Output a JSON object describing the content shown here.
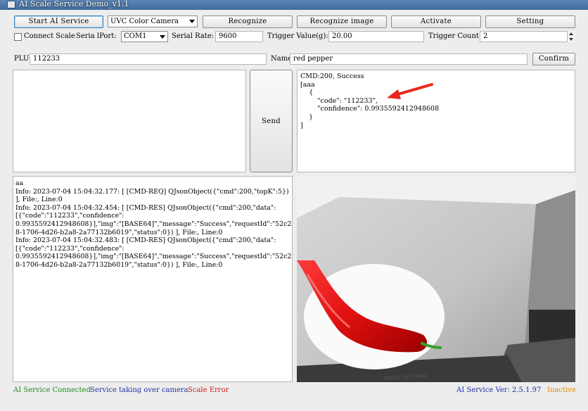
{
  "window": {
    "title": "AI Scale Service Demo_v1.1"
  },
  "toolbar": {
    "start_label": "Start AI Service",
    "camera_selected": "UVC Color Camera",
    "recognize_label": "Recognize",
    "recognize_image_label": "Recognize image",
    "activate_label": "Activate",
    "setting_label": "Setting"
  },
  "settings": {
    "connect_scale_label": "Connect Scale",
    "serial_port_label": "Seria lPort:",
    "serial_port_value": "COM1",
    "serial_rate_label": "Serial Rate:",
    "serial_rate_value": "9600",
    "trigger_value_label": "Trigger Value(g):",
    "trigger_value": "20.00",
    "trigger_count_label": "Trigger Count:",
    "trigger_count": "2"
  },
  "plu": {
    "plu_label": "PLU:",
    "plu_value": "112233",
    "name_label": "Name:",
    "name_value": "red pepper",
    "confirm_label": "Confirm"
  },
  "send": {
    "send_label": "Send",
    "input_value": ""
  },
  "response": {
    "lines": [
      "CMD:200, Success",
      "[aaa",
      "    {",
      "        \"code\": \"112233\",",
      "        \"confidence\": 0.9935592412948608",
      "    }",
      "]"
    ]
  },
  "log": {
    "lines": [
      "aa",
      "Info: 2023-07-04 15:04:32.177: [ [CMD-REQ] QJsonObject({\"cmd\":200,\"topK\":5})",
      "], File:, Line:0",
      "Info: 2023-07-04 15:04:32.454: [ [CMD-RES] QJsonObject({\"cmd\":200,\"data\":",
      "[{\"code\":\"112233\",\"confidence\":",
      "0.9935592412948608}],\"img\":\"[BASE64]\",\"message\":\"Success\",\"requestId\":\"52c2274",
      "8-1706-4d26-b2a8-2a77132b6019\",\"status\":0}) ], File:, Line:0",
      "Info: 2023-07-04 15:04:32.483: [ [CMD-RES] QJsonObject({\"cmd\":200,\"data\":",
      "[{\"code\":\"112233\",\"confidence\":",
      "0.9935592412948608}],\"img\":\"[BASE64]\",\"message\":\"Success\",\"requestId\":\"52c2274",
      "8-1706-4d26-b2a8-2a77132b6019\",\"status\":0}) ], File:, Line:0"
    ]
  },
  "camera": {
    "plate_text": "MADE IN CHINA"
  },
  "status": {
    "ai_connected": "AI Service Connected",
    "camera_takeover": "Service taking over camera",
    "scale_error": "Scale Error",
    "version": "AI Service Ver: 2.5.1.97",
    "activation": "Inactive",
    "colors": {
      "green": "#1c8a1c",
      "blue": "#1f2fa8",
      "red": "#d01818",
      "orange": "#d98b00"
    }
  }
}
